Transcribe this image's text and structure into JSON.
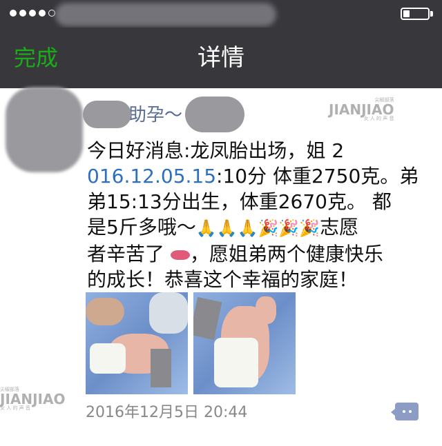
{
  "status_bar": {
    "signal_dots": 5,
    "signal_filled": 4,
    "battery_level": 0.25
  },
  "nav": {
    "done_label": "完成",
    "title": "详情"
  },
  "post": {
    "username": "助孕～",
    "lines": [
      "今日好消息:龙凤胎出场，姐 2",
      "016.12.05.15",
      ":10分 体重2750克。弟",
      "弟15:13分出生，体重2670克。 都",
      "是5斤多哦～",
      "🙏🙏🙏🎉🎉🎉",
      "志愿",
      "者辛苦了",
      "，愿姐弟两个健康快乐",
      "的成长！恭喜这个幸福的家庭！"
    ],
    "timestamp": "2016年12月5日 20:44",
    "link_color": "#2c6fc0",
    "photos": [
      "baby-photo-1",
      "baby-photo-2"
    ]
  },
  "watermark": {
    "brand": "JIANJIAO",
    "cn": "尖椒部落",
    "tagline": "女 人 的 声 音"
  },
  "colors": {
    "bar": "#38373c",
    "done": "#1aad19",
    "username": "#576b95"
  }
}
